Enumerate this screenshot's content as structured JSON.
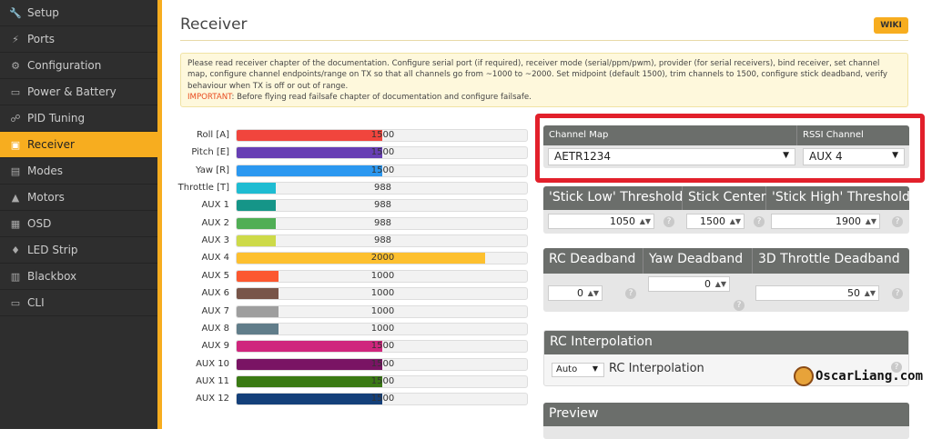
{
  "sidebar": {
    "items": [
      {
        "label": "Setup",
        "icon": "wrench-icon",
        "glyph": "🔧"
      },
      {
        "label": "Ports",
        "icon": "plug-icon",
        "glyph": "⚡"
      },
      {
        "label": "Configuration",
        "icon": "gear-icon",
        "glyph": "⚙"
      },
      {
        "label": "Power & Battery",
        "icon": "battery-icon",
        "glyph": "▭"
      },
      {
        "label": "PID Tuning",
        "icon": "sitemap-icon",
        "glyph": "☍"
      },
      {
        "label": "Receiver",
        "icon": "receiver-icon",
        "glyph": "▣",
        "active": true
      },
      {
        "label": "Modes",
        "icon": "toggle-icon",
        "glyph": "▤"
      },
      {
        "label": "Motors",
        "icon": "motor-icon",
        "glyph": "▲"
      },
      {
        "label": "OSD",
        "icon": "osd-icon",
        "glyph": "▦"
      },
      {
        "label": "LED Strip",
        "icon": "led-icon",
        "glyph": "♦"
      },
      {
        "label": "Blackbox",
        "icon": "blackbox-icon",
        "glyph": "▥"
      },
      {
        "label": "CLI",
        "icon": "terminal-icon",
        "glyph": "▭"
      }
    ]
  },
  "header": {
    "title": "Receiver",
    "wiki": "WIKI"
  },
  "notice": {
    "text": "Please read receiver chapter of the documentation. Configure serial port (if required), receiver mode (serial/ppm/pwm), provider (for serial receivers), bind receiver, set channel map, configure channel endpoints/range on TX so that all channels go from ~1000 to ~2000. Set midpoint (default 1500), trim channels to 1500, configure stick deadband, verify behaviour when TX is off or out of range.",
    "important_label": "IMPORTANT",
    "important_text": ": Before flying read failsafe chapter of documentation and configure failsafe."
  },
  "channels": [
    {
      "label": "Roll [A]",
      "value": 1500,
      "color": "#f1453d"
    },
    {
      "label": "Pitch [E]",
      "value": 1500,
      "color": "#673fb4"
    },
    {
      "label": "Yaw [R]",
      "value": 1500,
      "color": "#2b98f0"
    },
    {
      "label": "Throttle [T]",
      "value": 988,
      "color": "#1fbcd2"
    },
    {
      "label": "AUX 1",
      "value": 988,
      "color": "#159588"
    },
    {
      "label": "AUX 2",
      "value": 988,
      "color": "#50ae55"
    },
    {
      "label": "AUX 3",
      "value": 988,
      "color": "#cdda49"
    },
    {
      "label": "AUX 4",
      "value": 2000,
      "color": "#fdc02f"
    },
    {
      "label": "AUX 5",
      "value": 1000,
      "color": "#fc5830"
    },
    {
      "label": "AUX 6",
      "value": 1000,
      "color": "#785549"
    },
    {
      "label": "AUX 7",
      "value": 1000,
      "color": "#9e9e9e"
    },
    {
      "label": "AUX 8",
      "value": 1000,
      "color": "#617d8a"
    },
    {
      "label": "AUX 9",
      "value": 1500,
      "color": "#cf267d"
    },
    {
      "label": "AUX 10",
      "value": 1500,
      "color": "#7a1464"
    },
    {
      "label": "AUX 11",
      "value": 1500,
      "color": "#3a7a14"
    },
    {
      "label": "AUX 12",
      "value": 1500,
      "color": "#14407a"
    }
  ],
  "channel_range": [
    800,
    2200
  ],
  "channel_map": {
    "label": "Channel Map",
    "value": "AETR1234"
  },
  "rssi": {
    "label": "RSSI Channel",
    "value": "AUX 4"
  },
  "thresholds": {
    "low_label": "'Stick Low' Threshold",
    "low": "1050",
    "center_label": "Stick Center",
    "center": "1500",
    "high_label": "'Stick High' Threshold",
    "high": "1900"
  },
  "deadband": {
    "rc_label": "RC Deadband",
    "rc": "0",
    "yaw_label": "Yaw Deadband",
    "yaw": "0",
    "throttle3d_label": "3D Throttle Deadband",
    "throttle3d": "50"
  },
  "interpolation": {
    "title": "RC Interpolation",
    "value": "Auto",
    "label": "RC Interpolation"
  },
  "preview": {
    "title": "Preview"
  },
  "watermark": "OscarLiang.com",
  "highlight_color": "#e2202b"
}
